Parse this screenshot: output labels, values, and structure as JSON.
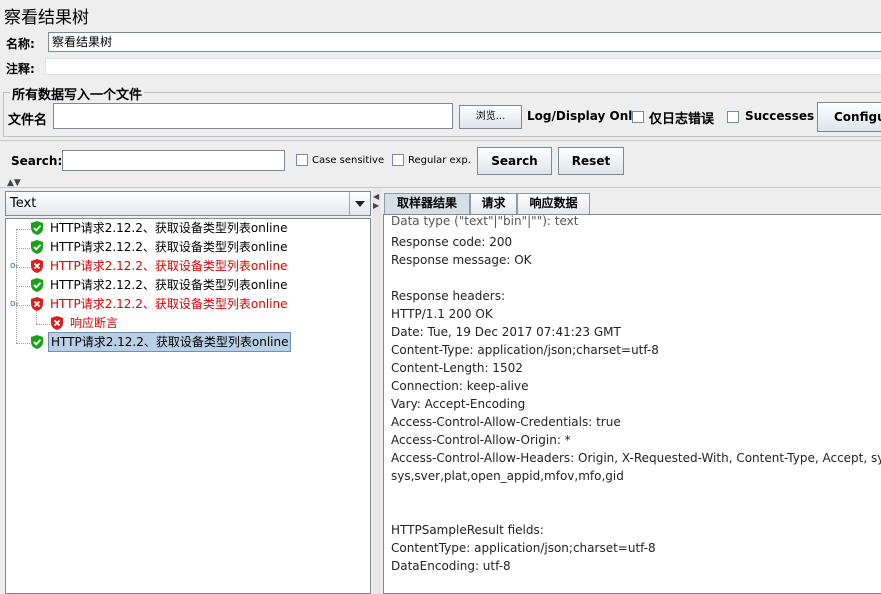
{
  "window": {
    "title": "察看结果树"
  },
  "form": {
    "name_label": "名称:",
    "name_value": "察看结果树",
    "comment_label": "注释:",
    "group_title": "所有数据写入一个文件",
    "file_label": "文件名",
    "file_value": "",
    "browse_label": "浏览...",
    "log_display_label": "Log/Display Only:",
    "errors_only_label": "仅日志错误",
    "successes_label": "Successes",
    "configure_label": "Configure"
  },
  "search": {
    "label": "Search:",
    "value": "",
    "case_label": "Case sensitive",
    "regex_label": "Regular exp.",
    "search_button": "Search",
    "reset_button": "Reset"
  },
  "tree": {
    "renderer": "Text",
    "nodes": [
      {
        "label": "HTTP请求2.12.2、获取设备类型列表online",
        "status": "ok"
      },
      {
        "label": "HTTP请求2.12.2、获取设备类型列表online",
        "status": "ok"
      },
      {
        "label": "HTTP请求2.12.2、获取设备类型列表online",
        "status": "error"
      },
      {
        "label": "HTTP请求2.12.2、获取设备类型列表online",
        "status": "ok"
      },
      {
        "label": "HTTP请求2.12.2、获取设备类型列表online",
        "status": "error"
      },
      {
        "label": "响应断言",
        "status": "error"
      },
      {
        "label": "HTTP请求2.12.2、获取设备类型列表online",
        "status": "ok"
      }
    ]
  },
  "tabs": [
    {
      "label": "取样器结果"
    },
    {
      "label": "请求"
    },
    {
      "label": "响应数据"
    }
  ],
  "result_lines": [
    "Data type (\"text\"|\"bin\"|\"\"): text",
    "Response code: 200",
    "Response message: OK",
    "",
    "Response headers:",
    "HTTP/1.1 200 OK",
    "Date: Tue, 19 Dec 2017 07:41:23 GMT",
    "Content-Type: application/json;charset=utf-8",
    "Content-Length: 1502",
    "Connection: keep-alive",
    "Vary: Accept-Encoding",
    "Access-Control-Allow-Credentials: true",
    "Access-Control-Allow-Origin: *",
    "Access-Control-Allow-Headers: Origin, X-Requested-With, Content-Type, Accept, sysver,",
    "sys,sver,plat,open_appid,mfov,mfo,gid",
    "",
    "",
    "HTTPSampleResult fields:",
    "ContentType: application/json;charset=utf-8",
    "DataEncoding: utf-8"
  ],
  "colors": {
    "ok": "#1aa11a",
    "error": "#d82020",
    "selected_bg": "#b8cfe5"
  }
}
